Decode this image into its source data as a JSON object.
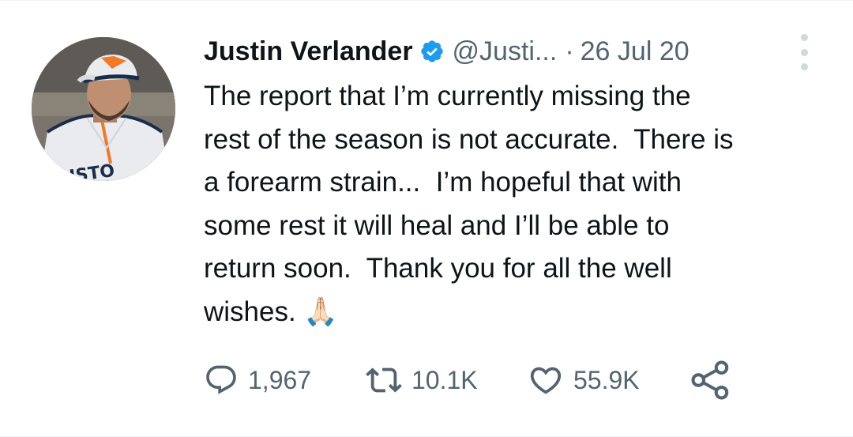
{
  "tweet": {
    "author_name": "Justin Verlander",
    "author_handle": "@Justi...",
    "separator": "·",
    "date": "26 Jul 20",
    "text": "The report that I’m currently missing the\nrest of the season is not accurate.  There is\na forearm strain...  I’m hopeful that with\nsome rest it will heal and I’ll be able to\nreturn soon.  Thank you for all the well\nwishes. 🙏🏻",
    "avatar_jersey_text": "USTO",
    "verified_icon": "verified-badge-icon",
    "accent_color": "#1d9bf0"
  },
  "actions": {
    "reply": {
      "icon": "reply-icon",
      "count": "1,967"
    },
    "retweet": {
      "icon": "retweet-icon",
      "count": "10.1K"
    },
    "like": {
      "icon": "heart-icon",
      "count": "55.9K"
    },
    "share": {
      "icon": "share-icon"
    }
  }
}
